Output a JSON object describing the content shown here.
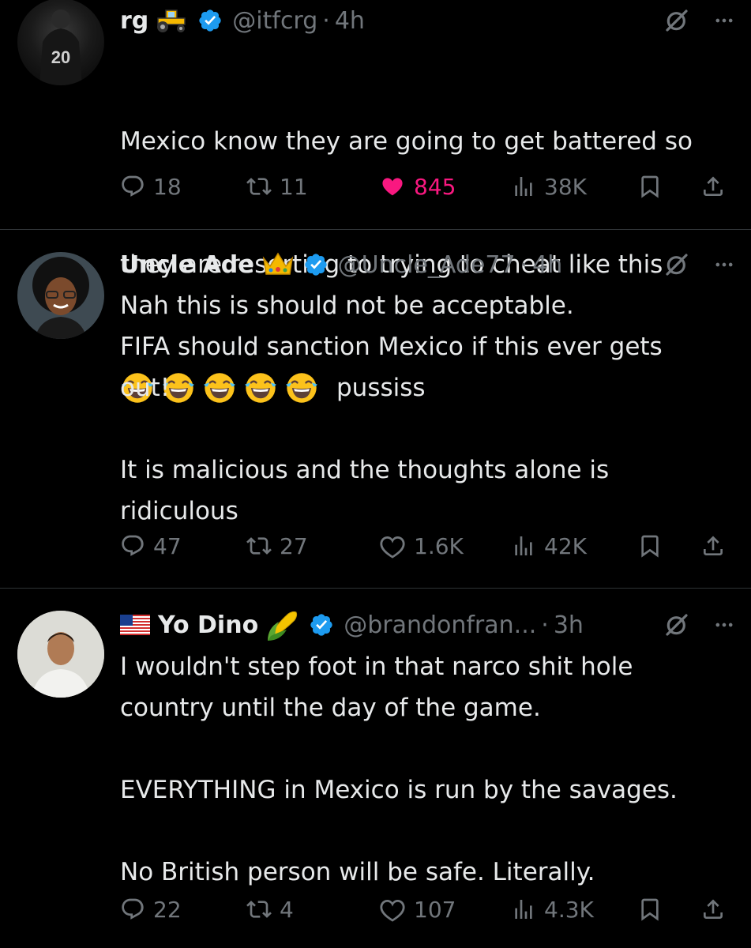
{
  "tweets": [
    {
      "name": "rg",
      "handle": "@itfcrg",
      "dot": "·",
      "time": "4h",
      "text_lines": [
        "Mexico know they are going to get battered so",
        "they are resorting to trying to cheat like this"
      ],
      "emoji_tail": "pussiss",
      "emoji": "face-with-tears-of-joy",
      "emoji_count": 5,
      "decoration_icon": "tractor-icon",
      "avatar_jersey_number": "20",
      "replies": "18",
      "reposts": "11",
      "likes": "845",
      "liked": true,
      "views": "38K"
    },
    {
      "name": "Uncle Ade",
      "handle": "@Uncle_Ade77",
      "dot": "·",
      "time": "4h",
      "text": "Nah this is should not be acceptable.\nFIFA should sanction Mexico if this ever gets\nout!\n\nIt is malicious and the thoughts alone is\nridiculous",
      "decoration_icon": "crown-icon",
      "replies": "47",
      "reposts": "27",
      "likes": "1.6K",
      "liked": false,
      "views": "42K"
    },
    {
      "name": "Yo Dino",
      "handle": "@brandonfran...",
      "dot": "·",
      "time": "3h",
      "text": "I wouldn't step foot in that narco shit hole\ncountry until the day of the game.\n\nEVERYTHING in Mexico is run by the savages.\n\nNo British person will be safe. Literally.",
      "flag_icon": "us-flag-icon",
      "decoration_icon": "corn-icon",
      "replies": "22",
      "reposts": "4",
      "likes": "107",
      "liked": false,
      "views": "4.3K"
    }
  ],
  "colors": {
    "background": "#000000",
    "text": "#e7e9ea",
    "muted": "#71767b",
    "verified": "#1d9bf0",
    "like": "#f91880",
    "divider": "#2f3336"
  }
}
